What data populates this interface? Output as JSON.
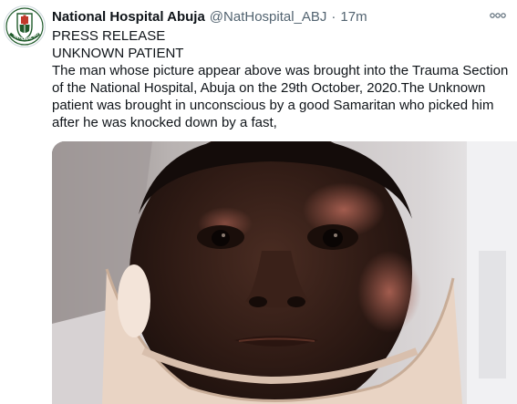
{
  "author": {
    "name": "National Hospital Abuja",
    "handle": "@NatHospital_ABJ",
    "separator": "·",
    "time": "17m",
    "avatar_text": "NATIONAL HOSPITAL"
  },
  "tweet": {
    "lines": [
      "PRESS RELEASE",
      "UNKNOWN PATIENT",
      "The man whose picture appear above was brought into the Trauma Section",
      "of the National Hospital, Abuja on the 29th October, 2020.The Unknown",
      "patient was brought in unconscious by a good Samaritan who picked him",
      "after he was knocked down by a fast,"
    ]
  },
  "icons": {
    "more": "more-options-icon",
    "avatar_logo": "hospital-logo-icon"
  },
  "colors": {
    "text": "#0f1419",
    "secondary": "#536471",
    "avatar_green": "#1f5a2a"
  }
}
